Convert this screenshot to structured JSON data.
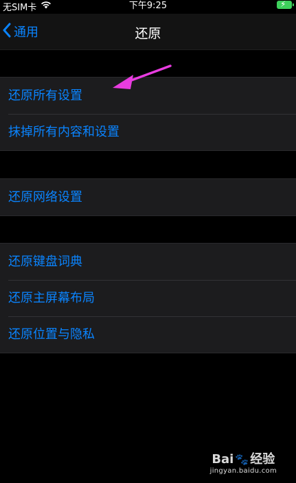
{
  "status_bar": {
    "carrier": "无SIM卡",
    "time": "下午9:25"
  },
  "nav": {
    "back_label": "通用",
    "title": "还原"
  },
  "groups": [
    {
      "items": [
        {
          "label": "还原所有设置"
        },
        {
          "label": "抹掉所有内容和设置"
        }
      ]
    },
    {
      "items": [
        {
          "label": "还原网络设置"
        }
      ]
    },
    {
      "items": [
        {
          "label": "还原键盘词典"
        },
        {
          "label": "还原主屏幕布局"
        },
        {
          "label": "还原位置与隐私"
        }
      ]
    }
  ],
  "colors": {
    "accent": "#0a84ff",
    "annotation": "#e83ce0",
    "background": "#000000",
    "cell": "#1c1c1e"
  },
  "watermark": {
    "brand_left": "Bai",
    "brand_right": "经验",
    "url": "jingyan.baidu.com"
  }
}
